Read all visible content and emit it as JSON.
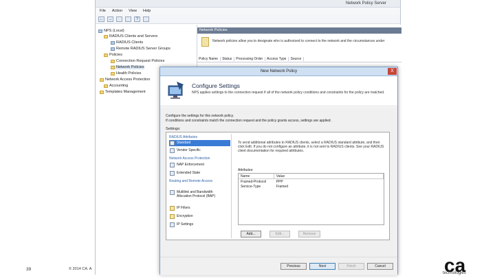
{
  "console": {
    "title": "Network Policy Server",
    "menu": [
      "File",
      "Action",
      "View",
      "Help"
    ],
    "tree": [
      {
        "label": "NPS (Local)",
        "level": 0
      },
      {
        "label": "RADIUS Clients and Servers",
        "level": 1
      },
      {
        "label": "RADIUS Clients",
        "level": 2
      },
      {
        "label": "Remote RADIUS Server Groups",
        "level": 2
      },
      {
        "label": "Policies",
        "level": 1
      },
      {
        "label": "Connection Request Policies",
        "level": 2
      },
      {
        "label": "Network Policies",
        "level": 2
      },
      {
        "label": "Health Policies",
        "level": 2
      },
      {
        "label": "Network Access Protection",
        "level": 1
      },
      {
        "label": "Accounting",
        "level": 1
      },
      {
        "label": "Templates Management",
        "level": 1
      }
    ],
    "panel_header": "Network Policies",
    "panel_description": "Network policies allow you to designate who is authorized to connect to the network and the circumstances under",
    "columns": [
      "Policy Name",
      "Status",
      "Processing Order",
      "Access Type",
      "Source"
    ]
  },
  "dialog": {
    "title": "New Network Policy",
    "close_glyph": "X",
    "heading": "Configure Settings",
    "subheading": "NPS applies settings to the connection request if all of the network policy conditions and constraints for the policy are matched.",
    "instructions_line1": "Configure the settings for this network policy.",
    "instructions_line2": "If conditions and constraints match the connection request and the policy grants access, settings are applied.",
    "settings_label": "Settings:",
    "groups": {
      "radius": "RADIUS Attributes",
      "nap": "Network Access Protection",
      "routing": "Routing and Remote Access"
    },
    "items": {
      "standard": "Standard",
      "vendor": "Vendor Specific",
      "nap_enforcement": "NAP Enforcement",
      "extended_state": "Extended State",
      "multilink": "Multilink and Bandwidth Allocation Protocol (BAP)",
      "ip_filters": "IP Filters",
      "encryption": "Encryption",
      "ip_settings": "IP Settings"
    },
    "detail_text": "To send additional attributes to RADIUS clients, select a RADIUS standard attribute, and then click Edit. If you do not configure an attribute, it is not sent to RADIUS clients. See your RADIUS client documentation for required attributes.",
    "attributes_label": "Attributes:",
    "attr_columns": [
      "Name",
      "Value"
    ],
    "attributes": [
      {
        "name": "Framed-Protocol",
        "value": "PPP"
      },
      {
        "name": "Service-Type",
        "value": "Framed"
      }
    ],
    "buttons": {
      "add": "Add...",
      "edit": "Edit...",
      "remove": "Remove",
      "previous": "Previous",
      "next": "Next",
      "finish": "Finish",
      "cancel": "Cancel"
    }
  },
  "slide": {
    "number": "39",
    "copyright": "© 2014 CA. A",
    "logo_text": "ca",
    "logo_tagline": "technologies"
  }
}
